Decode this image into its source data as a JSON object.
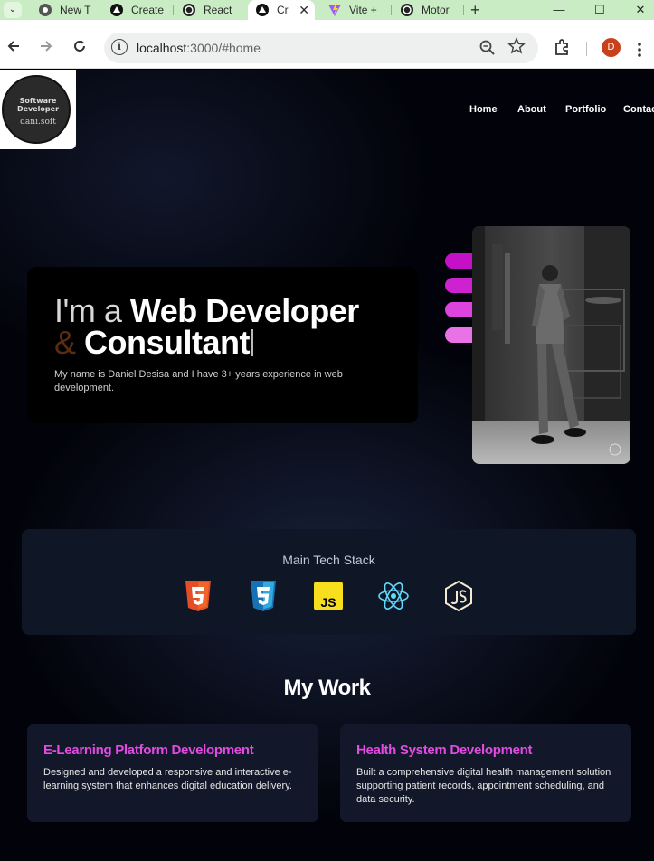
{
  "browser": {
    "tabs": [
      {
        "label": "New T",
        "icon": "chrome-icon"
      },
      {
        "label": "Create",
        "icon": "github-icon"
      },
      {
        "label": "React",
        "icon": "openai-icon"
      },
      {
        "label": "Cr",
        "icon": "triangle-icon",
        "active": true
      },
      {
        "label": "Vite +",
        "icon": "vite-icon"
      },
      {
        "label": "Motor",
        "icon": "openai-icon"
      }
    ],
    "new_tab": "+",
    "tab_menu": "⌄",
    "close_tab": "✕",
    "window": {
      "minimize": "—",
      "maximize": "☐",
      "close": "✕"
    },
    "url_host": "localhost",
    "url_path": ":3000/#home",
    "info_glyph": "i",
    "profile_initial": "D"
  },
  "site": {
    "logo": {
      "line1": "Software",
      "line2": "Developer",
      "line3": "dani.soft"
    },
    "nav": [
      "Home",
      "About",
      "Portfolio",
      "Contac"
    ],
    "hero": {
      "prefix": "I'm a ",
      "role": "Web Developer",
      "amp": "& ",
      "role2": "Consultant",
      "description": "My name is Daniel Desisa and I have 3+ years experience in web development."
    },
    "accent_colors": [
      "#c411c8",
      "#cc22d0",
      "#dd44dd",
      "#e872e6"
    ],
    "tech_stack": {
      "title": "Main Tech Stack",
      "icons": [
        "html5-icon",
        "css3-icon",
        "javascript-icon",
        "react-icon",
        "nodejs-icon"
      ],
      "js_label": "JS"
    },
    "work": {
      "title": "My Work",
      "projects": [
        {
          "title": "E-Learning Platform Development",
          "description": "Designed and developed a responsive and interactive e-learning system that enhances digital education delivery."
        },
        {
          "title": "Health System Development",
          "description": "Built a comprehensive digital health management solution supporting patient records, appointment scheduling, and data security."
        }
      ]
    }
  }
}
